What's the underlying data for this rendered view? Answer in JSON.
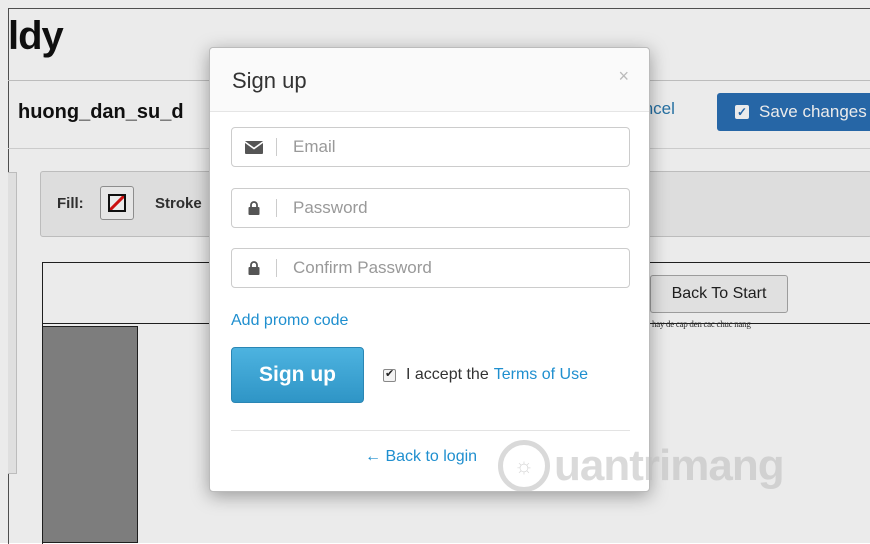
{
  "background": {
    "app_title": "ldy",
    "filename": "huong_dan_su_d",
    "cancel_label": "Cancel",
    "save_label": "Save changes",
    "fill_label": "Fill:",
    "stroke_label": "Stroke",
    "back_to_start_label": "Back To Start",
    "tiny_note": "hay de cap den cac chuc nang"
  },
  "modal": {
    "title": "Sign up",
    "close_glyph": "×",
    "email_placeholder": "Email",
    "password_placeholder": "Password",
    "confirm_placeholder": "Confirm Password",
    "promo_link": "Add promo code",
    "signup_button": "Sign up",
    "accept_text": "I accept the",
    "terms_link": "Terms of Use",
    "back_to_login": "← Back to login",
    "accept_checked": true
  },
  "watermark": {
    "text": "uantrimang"
  },
  "colors": {
    "link": "#1f8fcf",
    "signup_button": "#3aa3d4",
    "save_button": "#2a6fb5"
  },
  "icons": {
    "email": "envelope-icon",
    "password": "lock-icon",
    "confirm": "lock-icon"
  }
}
